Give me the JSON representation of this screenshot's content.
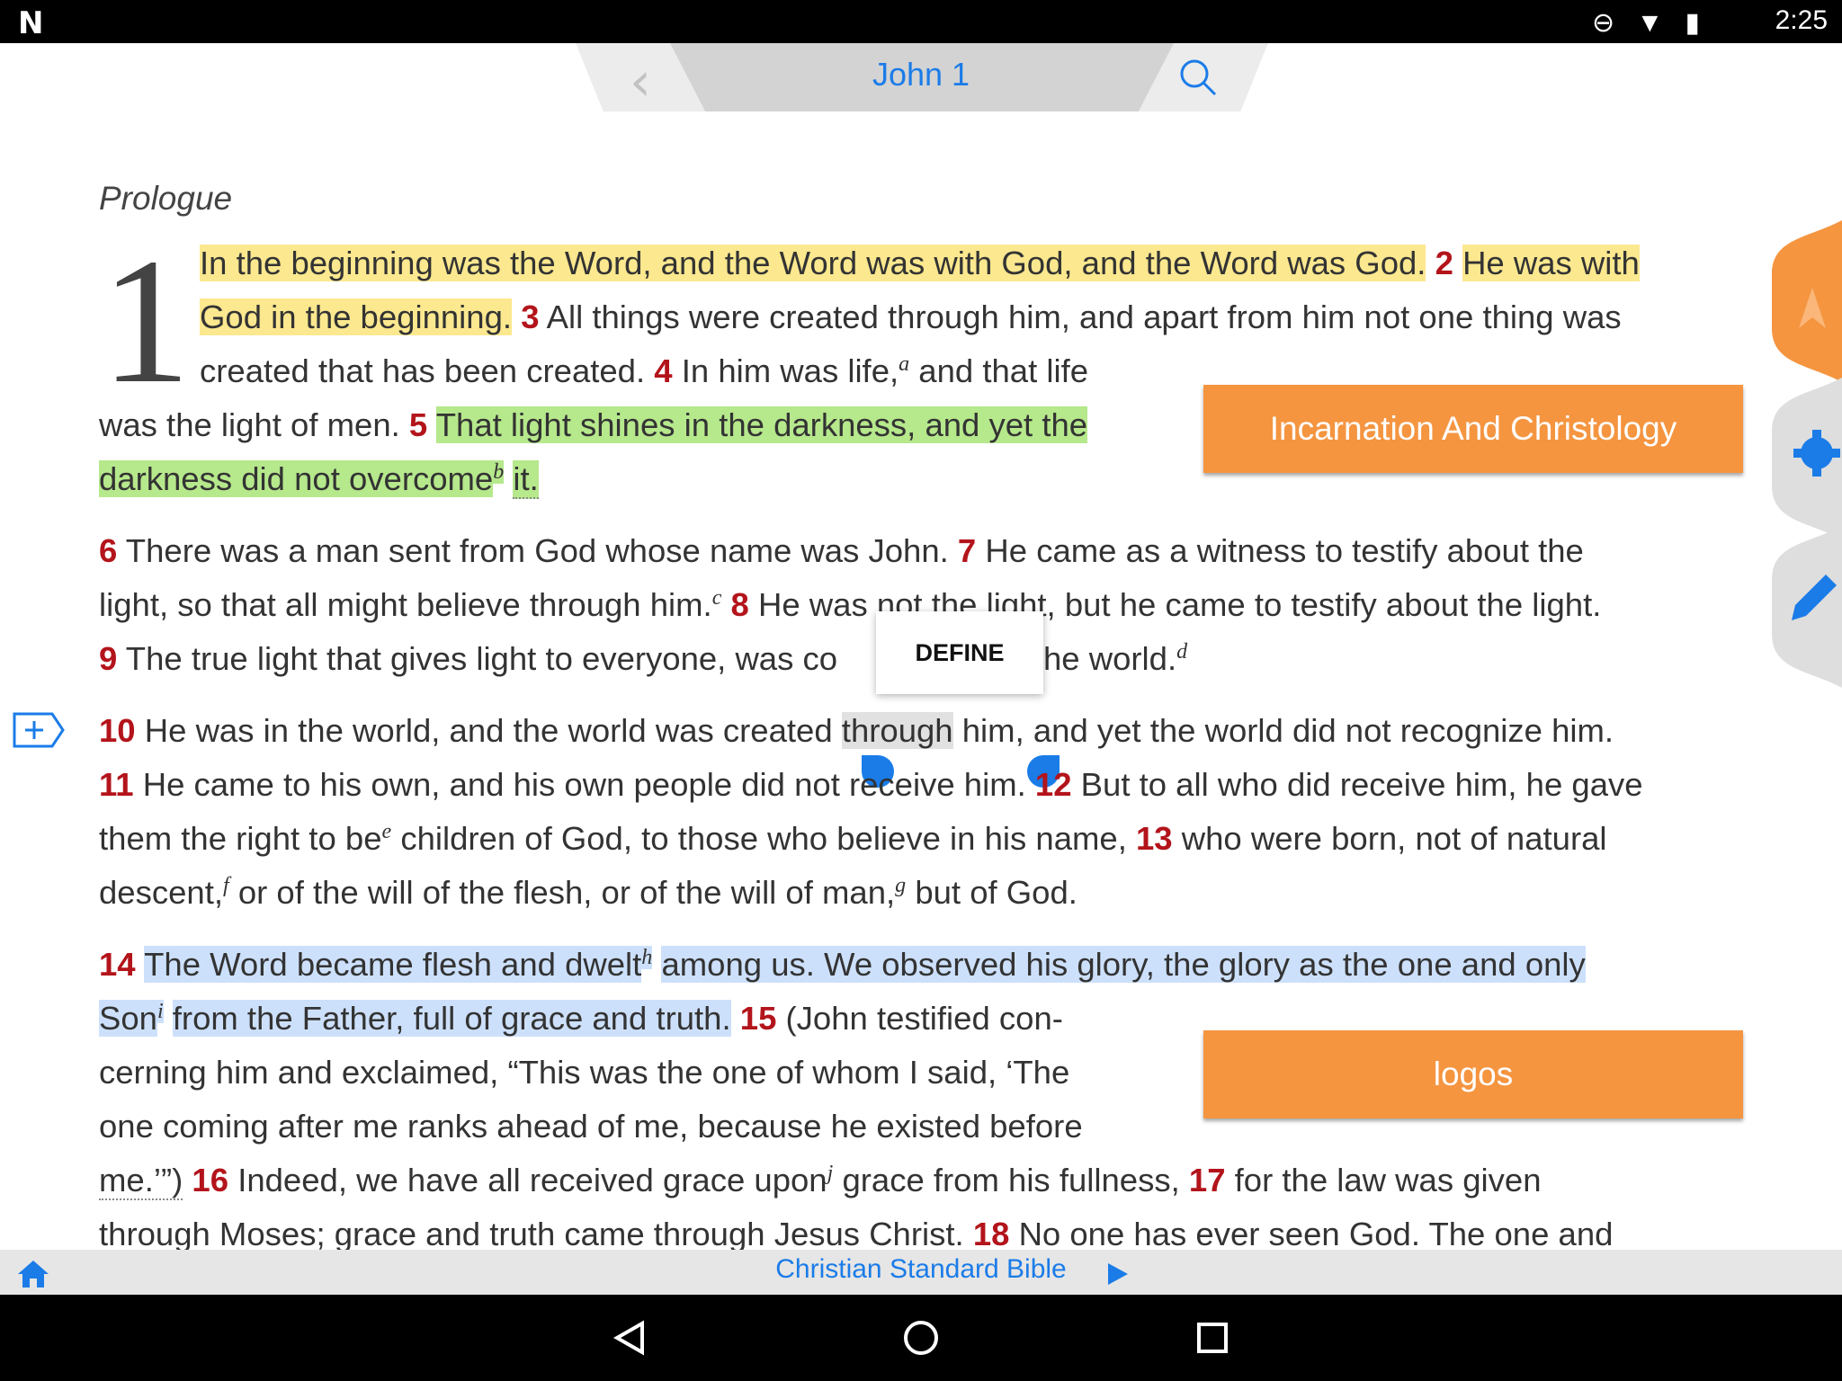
{
  "status_bar": {
    "notification_icon": "N",
    "system_icons": "⊖ ▼ ▮",
    "time": "2:25"
  },
  "header": {
    "book_chapter": "John 1",
    "back_icon": "chevron-left-icon",
    "search_icon": "search-icon"
  },
  "section_heading": "Prologue",
  "chapter_number": "1",
  "tags": {
    "tag1": "Incarnation And Christology",
    "tag2": "logos"
  },
  "popup": {
    "define_label": "DEFINE"
  },
  "footer": {
    "bible_name": "Christian Standard Bible",
    "home_icon": "home-icon",
    "play_icon": "play-icon"
  },
  "side_tools": [
    "navigation-arrow-icon",
    "settings-gear-icon",
    "pencil-edit-icon"
  ],
  "add_note_icon": "add-note-icon",
  "colors": {
    "accent_blue": "#1b7ce8",
    "verse_red": "#b3141b",
    "tag_orange": "#f59540",
    "highlight_yellow": "#fbe88f",
    "highlight_green": "#b6e88c",
    "highlight_blue": "#cde0fb"
  },
  "text": {
    "l1": "In the beginning was the Word, and the Word was with God, and the Word was God.",
    "v2": "2",
    "l1b": "He was with",
    "l2a": "God in the beginning.",
    "v3": "3",
    "l2b": "All things were created through him, and apart from him not one thing was",
    "l3a": "created that has been created.",
    "v4": "4",
    "l3b": "In him was life,",
    "fa": "a",
    "l3c": "and that life",
    "l4a": "was the light of men.",
    "v5": "5",
    "l4b": "That light shines in the darkness, and yet the",
    "l5a": "darkness did not overcome",
    "fb": "b",
    "l5b": "it.",
    "v6": "6",
    "l6": "There was a man sent from God whose name was John.",
    "v7": "7",
    "l6b": "He came as a witness to testify about the",
    "l7a": "light, so that all might believe through him.",
    "fc": "c",
    "v8": "8",
    "l7b": "He was not the light, but he came to testify about the light.",
    "v9": "9",
    "l8a": "The true light that gives light to everyone, was co",
    "l8b": "he world.",
    "fd": "d",
    "v10": "10",
    "l9a": "He was in the world, and the world was created",
    "l9sel": "through",
    "l9b": "him, and yet the world did not recognize him.",
    "v11": "11",
    "l10a": "He came to his own, and his own people did not receive him.",
    "v12": "12",
    "l10b": "But to all who did receive him, he gave",
    "l11a": "them the right to be",
    "fe": "e",
    "l11b": "children of God, to those who believe in his name,",
    "v13": "13",
    "l11c": "who were born, not of natural",
    "l12a": "descent,",
    "ff": "f",
    "l12b": "or of the will of the flesh, or of the will of man,",
    "fg": "g",
    "l12c": "but of God.",
    "v14": "14",
    "l13a": "The Word became flesh and dwelt",
    "fh": "h",
    "l13b": "among us. We observed his glory, the glory as the one and only",
    "l14a": "Son",
    "fi": "i",
    "l14b": "from the Father, full of grace and truth.",
    "v15": "15",
    "l14c": "(John testified con-",
    "l15": "cerning him and exclaimed, “This was the one of whom I said, ‘The",
    "l16": "one coming after me ranks ahead of me, because he existed before",
    "l17a": "me.’”)",
    "v16": "16",
    "l17b": "Indeed, we have all received grace upon",
    "fj": "j",
    "l17c": "grace from his fullness,",
    "v17": "17",
    "l17d": "for the law was given",
    "l18a": "through Moses; grace and truth came through Jesus Christ.",
    "v18": "18",
    "l18b": "No one has ever seen God. The one and"
  }
}
